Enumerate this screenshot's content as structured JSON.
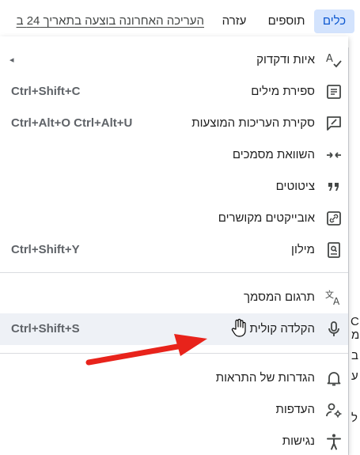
{
  "menubar": {
    "last_edit": "העריכה האחרונה בוצעה בתאריך 24 ב",
    "help": "עזרה",
    "addons": "תוספים",
    "tools": "כלים"
  },
  "tools_menu": {
    "items": [
      {
        "label": "איות ודקדוק",
        "shortcut": "",
        "icon": "spellcheck-icon",
        "submenu": "◂"
      },
      {
        "label": "ספירת מילים",
        "shortcut": "Ctrl+Shift+C",
        "icon": "word-count-icon"
      },
      {
        "label": "סקירת העריכות המוצעות",
        "shortcut": "Ctrl+Alt+O Ctrl+Alt+U",
        "icon": "review-edits-icon"
      },
      {
        "label": "השוואת מסמכים",
        "shortcut": "",
        "icon": "compare-documents-icon"
      },
      {
        "label": "ציטוטים",
        "shortcut": "",
        "icon": "citations-icon"
      },
      {
        "label": "אובייקטים מקושרים",
        "shortcut": "",
        "icon": "linked-objects-icon"
      },
      {
        "label": "מילון",
        "shortcut": "Ctrl+Shift+Y",
        "icon": "dictionary-icon"
      },
      {
        "label": "תרגום המסמך",
        "shortcut": "",
        "icon": "translate-icon"
      },
      {
        "label": "הקלדה קולית",
        "shortcut": "Ctrl+Shift+S",
        "icon": "microphone-icon",
        "highlighted": true
      },
      {
        "label": "הגדרות של התראות",
        "shortcut": "",
        "icon": "bell-icon"
      },
      {
        "label": "העדפות",
        "shortcut": "",
        "icon": "preferences-icon"
      },
      {
        "label": "נגישות",
        "shortcut": "",
        "icon": "accessibility-icon"
      }
    ]
  },
  "doc_peek": {
    "glyphs": [
      "C",
      "מ",
      "ב",
      "ע",
      "ל"
    ]
  },
  "colors": {
    "tools_active_bg": "#d3e3fd",
    "tools_active_text": "#0b57d0",
    "highlight_row": "#eef1f6",
    "annotation_arrow": "#e8231b"
  }
}
